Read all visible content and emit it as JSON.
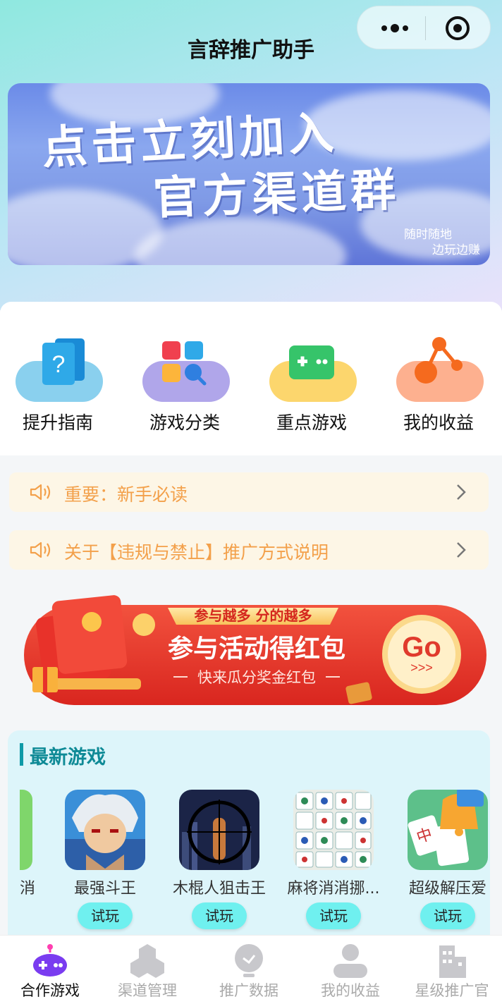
{
  "header": {
    "title": "言辞推广助手"
  },
  "banner": {
    "line1": "点击立刻加入",
    "line2": "官方渠道群",
    "sub1": "随时随地",
    "sub2": "边玩边赚"
  },
  "quick_menu": [
    {
      "label": "提升指南",
      "icon": "guide-icon",
      "color": "#8ad0ee"
    },
    {
      "label": "游戏分类",
      "icon": "category-icon",
      "color": "#b0a6ea"
    },
    {
      "label": "重点游戏",
      "icon": "gamepad-icon",
      "color": "#fcd66d"
    },
    {
      "label": "我的收益",
      "icon": "earnings-icon",
      "color": "#fdb08f"
    }
  ],
  "notices": [
    {
      "text": "重要：新手必读"
    },
    {
      "text": "关于【违规与禁止】推广方式说明"
    }
  ],
  "promo": {
    "tag": "参与越多 分的越多",
    "title": "参与活动得红包",
    "subtitle": "快来瓜分奖金红包",
    "go": "Go",
    "arrows": ">>>"
  },
  "new_games": {
    "title": "最新游戏",
    "partial_name": "消",
    "items": [
      {
        "name": "最强斗王",
        "button": "试玩",
        "icon": "fighter-game-icon"
      },
      {
        "name": "木棍人狙击王",
        "button": "试玩",
        "icon": "sniper-game-icon"
      },
      {
        "name": "麻将消消挪...",
        "button": "试玩",
        "icon": "mahjong-game-icon"
      },
      {
        "name": "超级解压爱",
        "button": "试玩",
        "icon": "mahjong-bell-game-icon"
      }
    ]
  },
  "tabbar": {
    "items": [
      {
        "label": "合作游戏",
        "icon": "game-controller-icon",
        "active": true
      },
      {
        "label": "渠道管理",
        "icon": "channel-icon",
        "active": false
      },
      {
        "label": "推广数据",
        "icon": "data-icon",
        "active": false
      },
      {
        "label": "我的收益",
        "icon": "user-icon",
        "active": false
      },
      {
        "label": "星级推广官",
        "icon": "building-icon",
        "active": false
      }
    ]
  },
  "colors": {
    "accent": "#0e9aa7",
    "notice_text": "#f3a04a",
    "play_button": "#6ff0ef",
    "promo_red": "#e53a2f"
  }
}
